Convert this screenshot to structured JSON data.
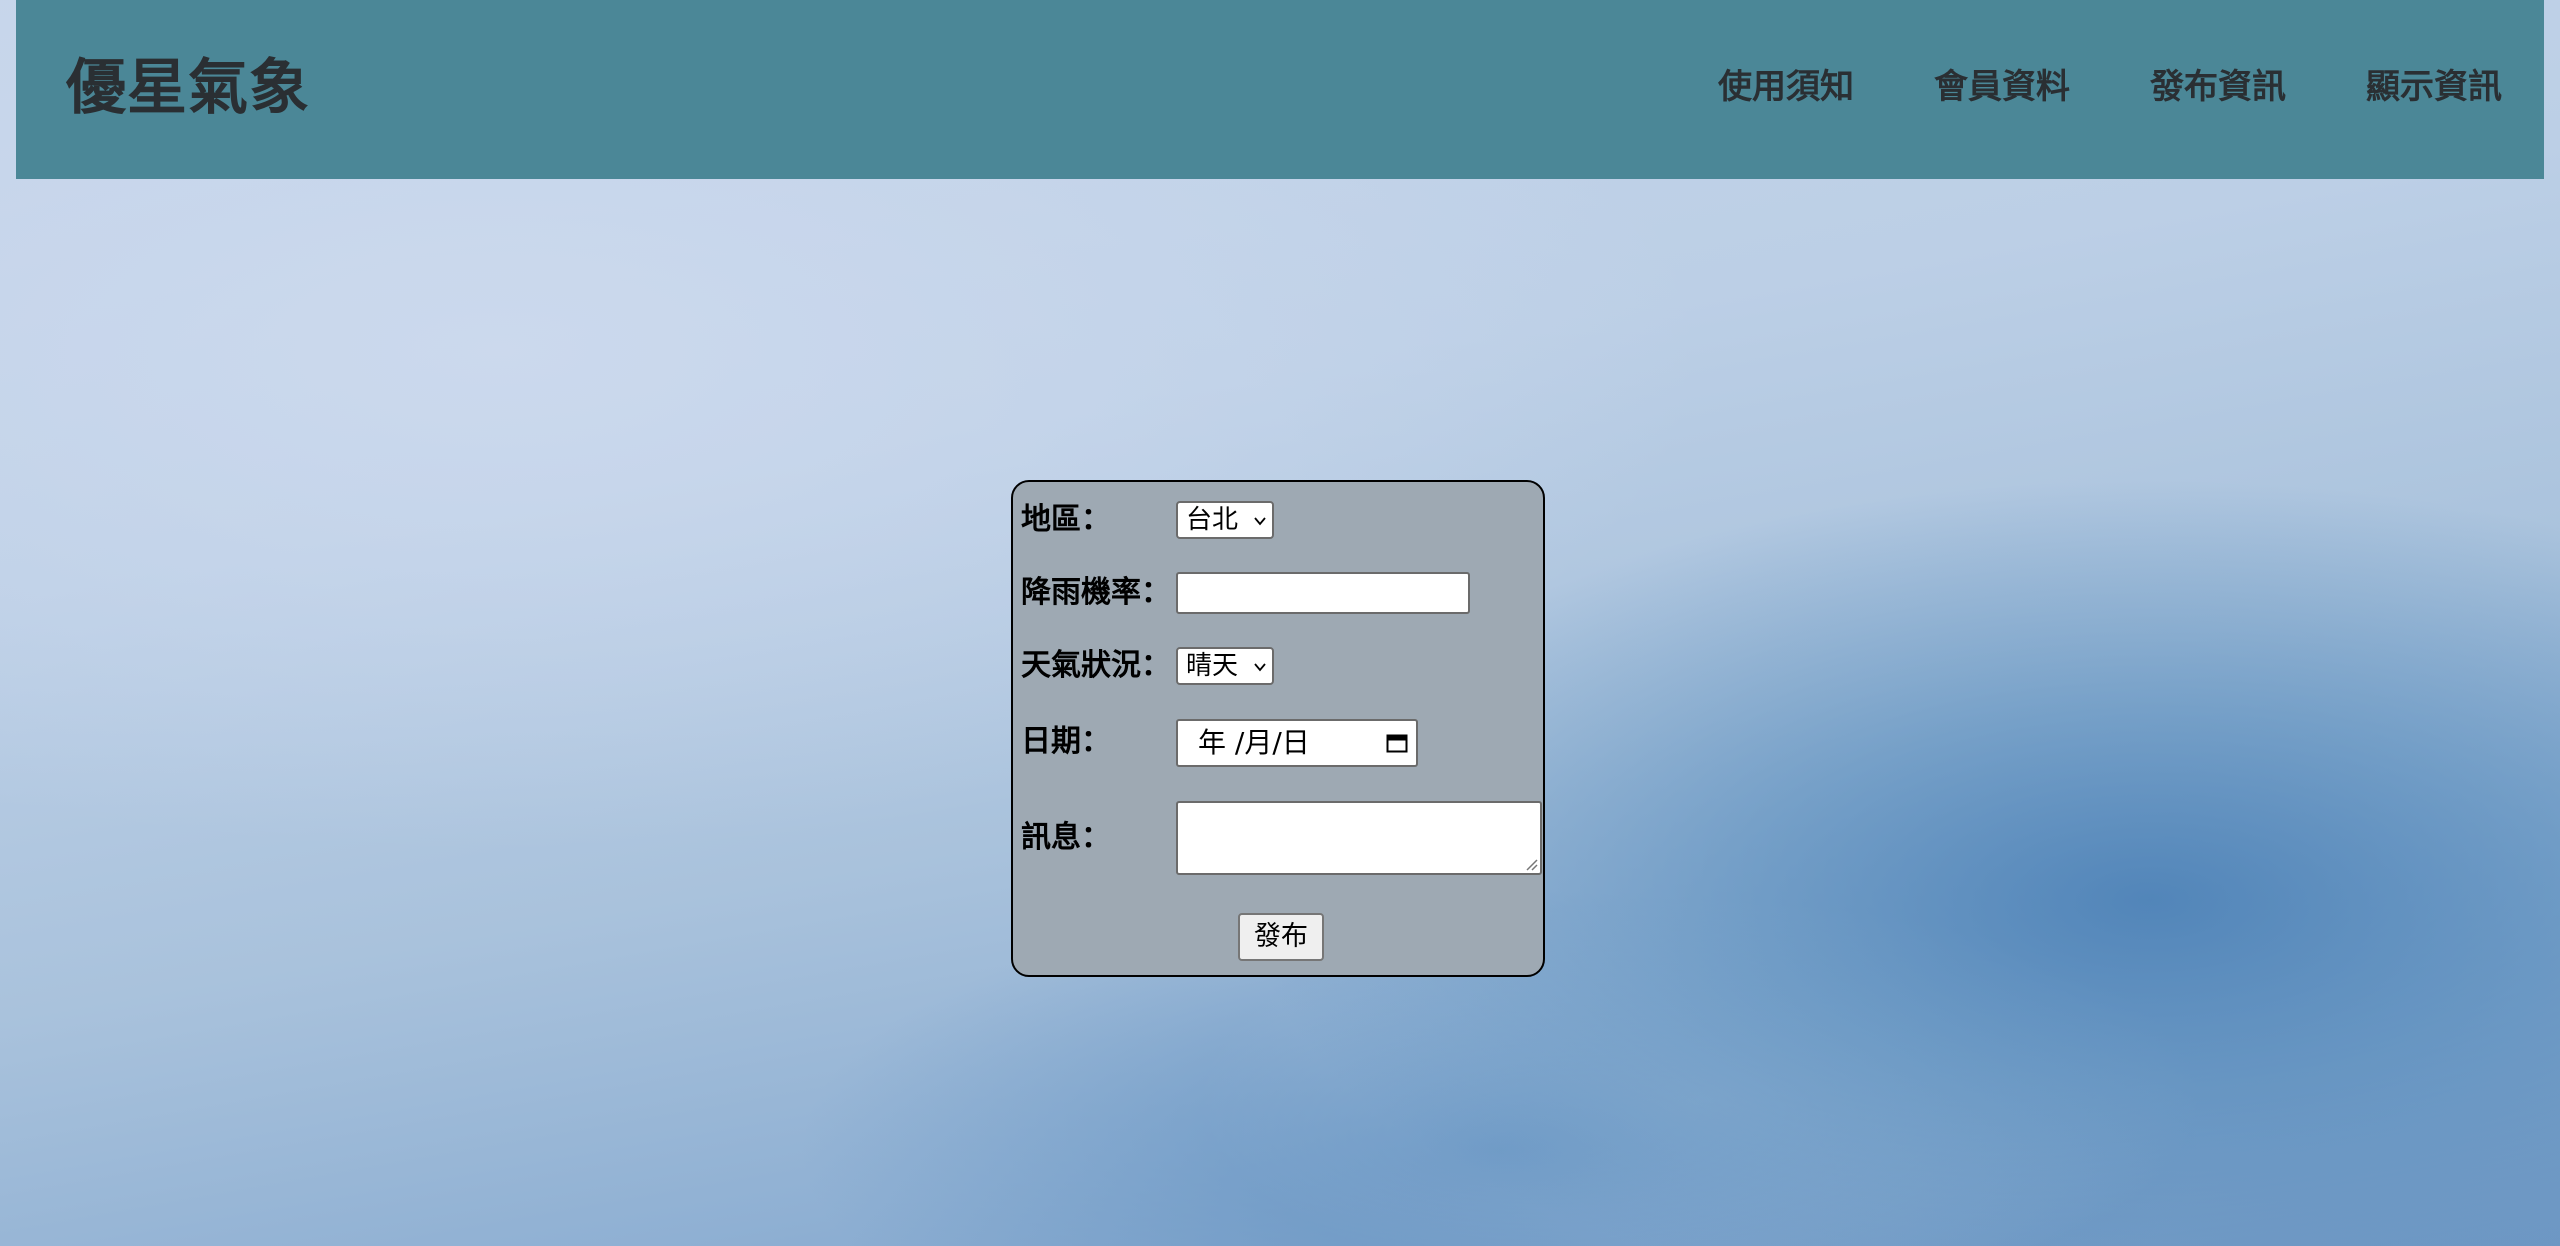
{
  "header": {
    "logo": "優星氣象",
    "nav": [
      "使用須知",
      "會員資料",
      "發布資訊",
      "顯示資訊"
    ]
  },
  "form": {
    "region": {
      "label": "地區：",
      "selected": "台北"
    },
    "rain_probability": {
      "label": "降雨機率：",
      "value": ""
    },
    "weather": {
      "label": "天氣狀況：",
      "selected": "晴天"
    },
    "date": {
      "label": "日期：",
      "placeholder": "年 /月/日"
    },
    "message": {
      "label": "訊息：",
      "value": ""
    },
    "submit_label": "發布"
  },
  "colors": {
    "header_bg": "#4b8797",
    "form_bg": "#9ea9b3"
  }
}
